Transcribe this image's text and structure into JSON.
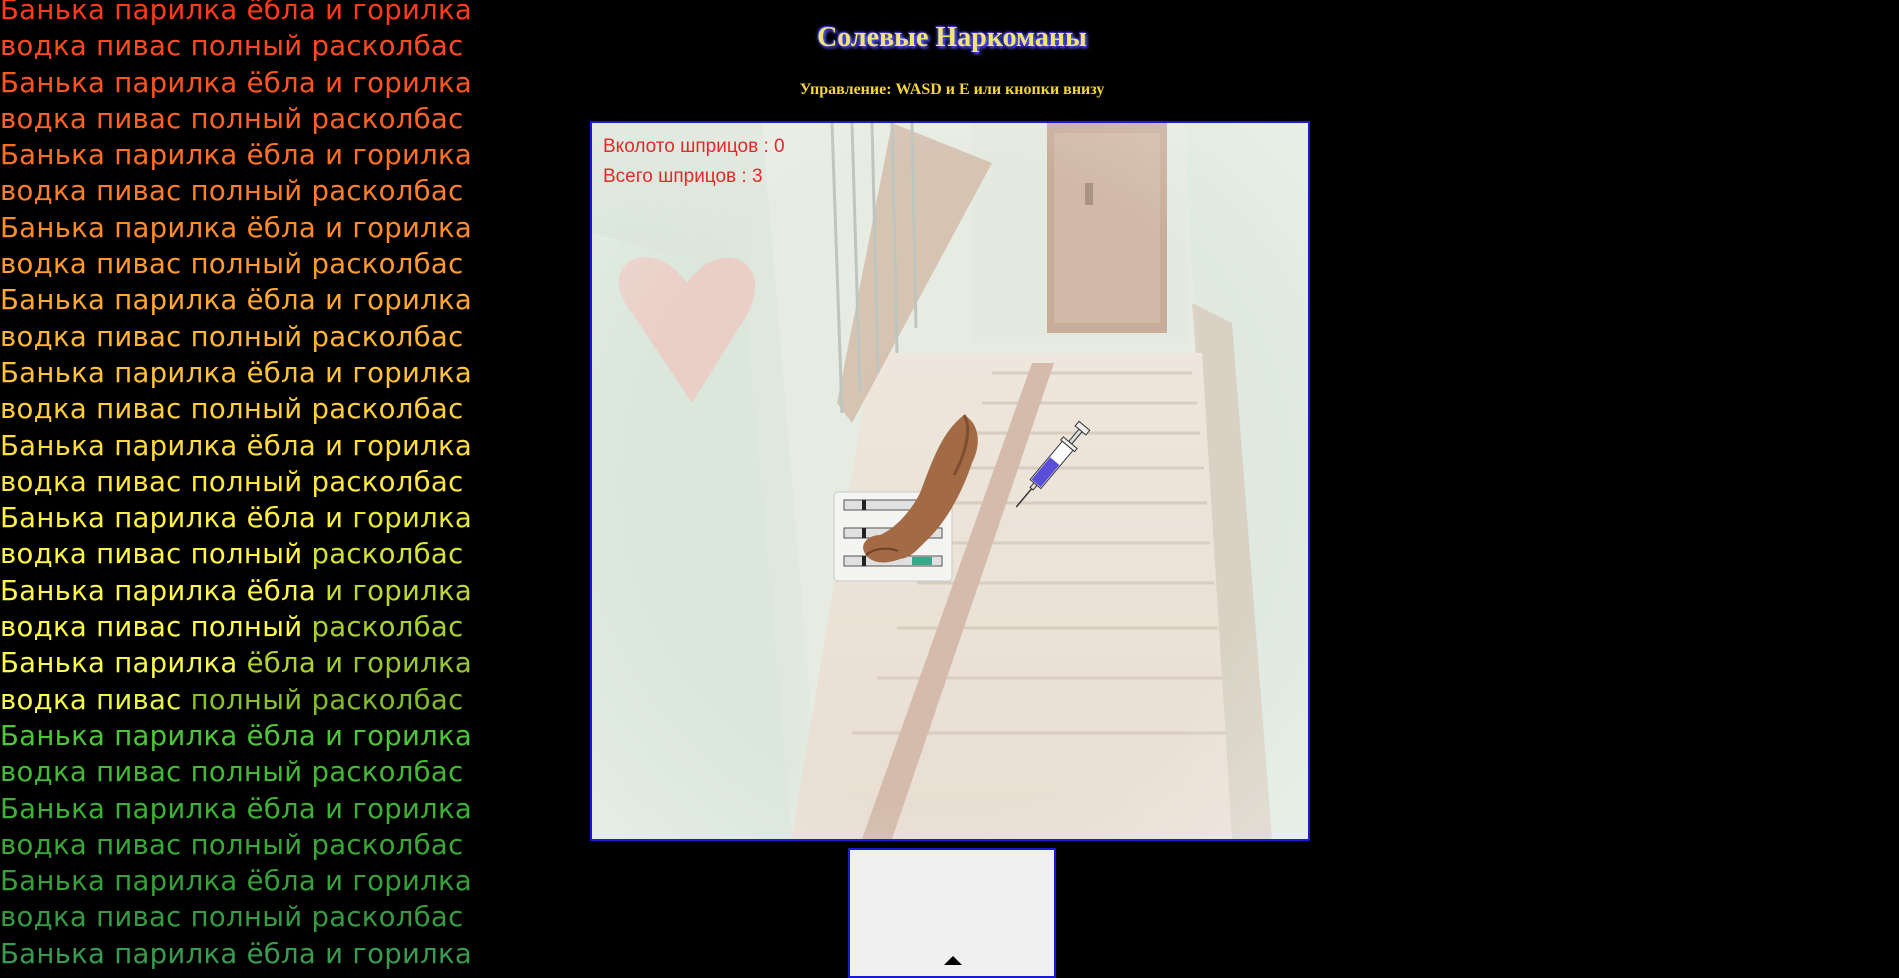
{
  "poem": {
    "line_a": [
      "Банька",
      "парилка",
      "ёбла",
      "и",
      "горилка"
    ],
    "line_b": [
      "водка",
      "пивас",
      "полный",
      "расколбас"
    ],
    "rows": [
      {
        "kind": "a",
        "colors": [
          "#ff3b1c",
          "#ff3b1c",
          "#ff3b1c",
          "#ff3b1c",
          "#ff3b1c"
        ]
      },
      {
        "kind": "b",
        "colors": [
          "#ff4a1f",
          "#ff4a1f",
          "#ff4a1f",
          "#ff4a1f"
        ]
      },
      {
        "kind": "a",
        "colors": [
          "#ff5520",
          "#ff5520",
          "#ff5520",
          "#ff5520",
          "#ff5520"
        ]
      },
      {
        "kind": "b",
        "colors": [
          "#ff6222",
          "#ff6222",
          "#ff6222",
          "#ff6222"
        ]
      },
      {
        "kind": "a",
        "colors": [
          "#ff7024",
          "#ff7024",
          "#ff7024",
          "#ff7024",
          "#ff7024"
        ]
      },
      {
        "kind": "b",
        "colors": [
          "#ff7e28",
          "#ff7e28",
          "#ff7e28",
          "#ff7e28"
        ]
      },
      {
        "kind": "a",
        "colors": [
          "#ff8c2b",
          "#ff8c2b",
          "#ff8c2b",
          "#ff8c2b",
          "#ff8c2b"
        ]
      },
      {
        "kind": "b",
        "colors": [
          "#ff9a2e",
          "#ff9a2e",
          "#ff9a2e",
          "#ff9a2e"
        ]
      },
      {
        "kind": "a",
        "colors": [
          "#ffa832",
          "#ffa832",
          "#ffa832",
          "#ffa832",
          "#ffa832"
        ]
      },
      {
        "kind": "b",
        "colors": [
          "#ffb535",
          "#ffb535",
          "#ffb535",
          "#ffb535"
        ]
      },
      {
        "kind": "a",
        "colors": [
          "#ffc238",
          "#ffc238",
          "#ffc238",
          "#ffc238",
          "#ffc238"
        ]
      },
      {
        "kind": "b",
        "colors": [
          "#ffcf3b",
          "#ffcf3b",
          "#ffcf3b",
          "#ffcf3b"
        ]
      },
      {
        "kind": "a",
        "colors": [
          "#ffdc3f",
          "#ffdc3f",
          "#ffdc3f",
          "#ffdc3f",
          "#ffdc3f"
        ]
      },
      {
        "kind": "b",
        "colors": [
          "#ffe742",
          "#ffe742",
          "#ffe742",
          "#ffe742"
        ]
      },
      {
        "kind": "a",
        "colors": [
          "#fff045",
          "#fff045",
          "#fff045",
          "#fff045",
          "#e6e838"
        ]
      },
      {
        "kind": "b",
        "colors": [
          "#fff548",
          "#fff548",
          "#fff548",
          "#d5e236"
        ]
      },
      {
        "kind": "a",
        "colors": [
          "#fff84a",
          "#fff84a",
          "#fff84a",
          "#c8dc34",
          "#c0d633"
        ]
      },
      {
        "kind": "b",
        "colors": [
          "#fffb4c",
          "#fffb4c",
          "#fffb4c",
          "#a9d130"
        ]
      },
      {
        "kind": "a",
        "colors": [
          "#fdfc4d",
          "#f8fa4c",
          "#b0d230",
          "#a2cc2e",
          "#9ac72d"
        ]
      },
      {
        "kind": "b",
        "colors": [
          "#f8fb4c",
          "#e9f649",
          "#8bc02b",
          "#84bb2a"
        ]
      },
      {
        "kind": "a",
        "colors": [
          "#4fc53a",
          "#4fc53a",
          "#4fc53a",
          "#4fc53a",
          "#4fc53a"
        ]
      },
      {
        "kind": "b",
        "colors": [
          "#45b836",
          "#45b836",
          "#45b836",
          "#45b836"
        ]
      },
      {
        "kind": "a",
        "colors": [
          "#3fb037",
          "#3fb037",
          "#3fb037",
          "#3fb037",
          "#3fb037"
        ]
      },
      {
        "kind": "b",
        "colors": [
          "#3aa738",
          "#3aa738",
          "#3aa738",
          "#3aa738"
        ]
      },
      {
        "kind": "a",
        "colors": [
          "#389f3c",
          "#389f3c",
          "#389f3c",
          "#389f3c",
          "#389f3c"
        ]
      },
      {
        "kind": "b",
        "colors": [
          "#389a44",
          "#389a44",
          "#389a44",
          "#389a44"
        ]
      },
      {
        "kind": "a",
        "colors": [
          "#3a9a4f",
          "#3a9a4f",
          "#3a9a4f",
          "#3a9a4f",
          "#3a9a4f"
        ]
      }
    ]
  },
  "header": {
    "title": "Солевые Наркоманы",
    "controls": "Управление: WASD и E или кнопки внизу"
  },
  "hud": {
    "injected": "Вколото шприцов : 0",
    "total": "Всего шприцов : 3"
  },
  "colors": {
    "hud_text": "#e22a2a",
    "title_text": "#f2e27a",
    "controls_text": "#f4d53a",
    "frame_border": "#1a1ad6",
    "page_bg": "#000000"
  },
  "sprites": {
    "player": "muscular-arm-icon",
    "syringe_pack": "syringe-pack-icon",
    "syringe": "syringe-icon",
    "pad_up": "arrow-up-icon"
  }
}
